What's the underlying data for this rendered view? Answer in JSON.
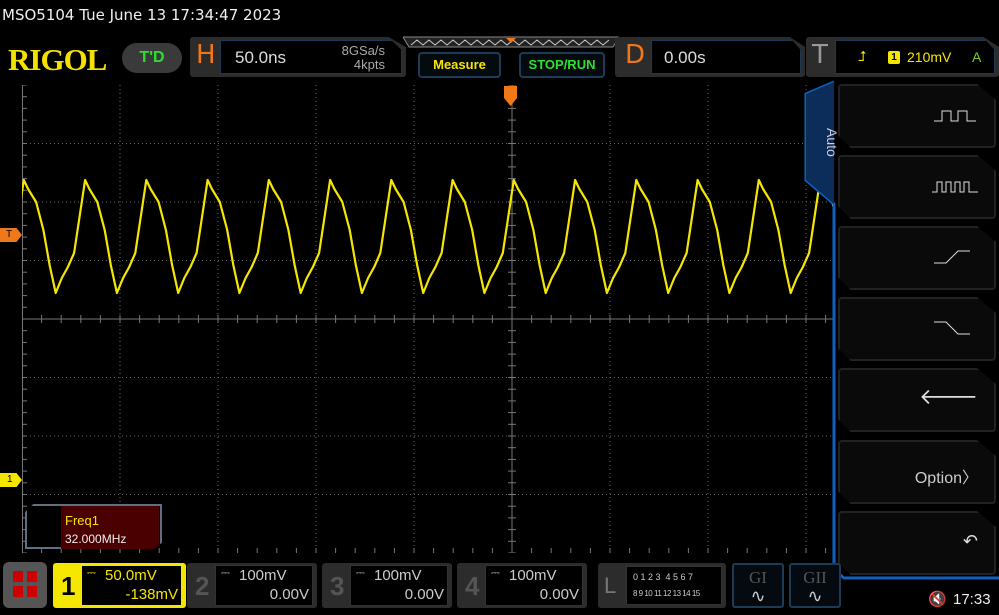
{
  "title": "MSO5104  Tue June 13 17:34:47 2023",
  "logo": "RIGOL",
  "status": "T'D",
  "horizontal": {
    "letter": "H",
    "timebase": "50.0ns",
    "sample_rate": "8GSa/s",
    "memory_depth": "4kpts"
  },
  "buttons": {
    "measure": "Measure",
    "stop_run": "STOP/RUN"
  },
  "delay": {
    "letter": "D",
    "value": "0.00s"
  },
  "trigger": {
    "letter": "T",
    "source": "1",
    "level": "210mV",
    "mode": "A",
    "edge_icon": "rising-edge-icon"
  },
  "markers": {
    "trigger": "T",
    "ch1": "1"
  },
  "measurement": {
    "label": "Freq1",
    "value": "32.000MHz"
  },
  "menu": {
    "tab": "Auto",
    "items": [
      {
        "icon": "single-pulse-icon"
      },
      {
        "icon": "multi-pulse-icon"
      },
      {
        "icon": "rise-edge-icon"
      },
      {
        "icon": "fall-edge-icon"
      },
      {
        "icon": "back-arrow-icon"
      },
      {
        "label": "Option",
        "icon": "chevron-right-icon"
      },
      {
        "icon": "undo-icon"
      }
    ]
  },
  "channels": [
    {
      "num": "1",
      "scale": "50.0mV",
      "offset": "-138mV",
      "active": true
    },
    {
      "num": "2",
      "scale": "100mV",
      "offset": "0.00V"
    },
    {
      "num": "3",
      "scale": "100mV",
      "offset": "0.00V"
    },
    {
      "num": "4",
      "scale": "100mV",
      "offset": "0.00V"
    }
  ],
  "logic": {
    "letter": "L",
    "row1": "0 1 2 3  4 5 6 7",
    "row2": "8 9 10 11 12 13 14 15"
  },
  "generators": [
    {
      "label": "GI"
    },
    {
      "label": "GII"
    }
  ],
  "clock": "17:33",
  "colors": {
    "ch1": "#f5e600",
    "accent": "#f07818",
    "menu_blue": "#1060c0",
    "status_green": "#2ee02e"
  }
}
